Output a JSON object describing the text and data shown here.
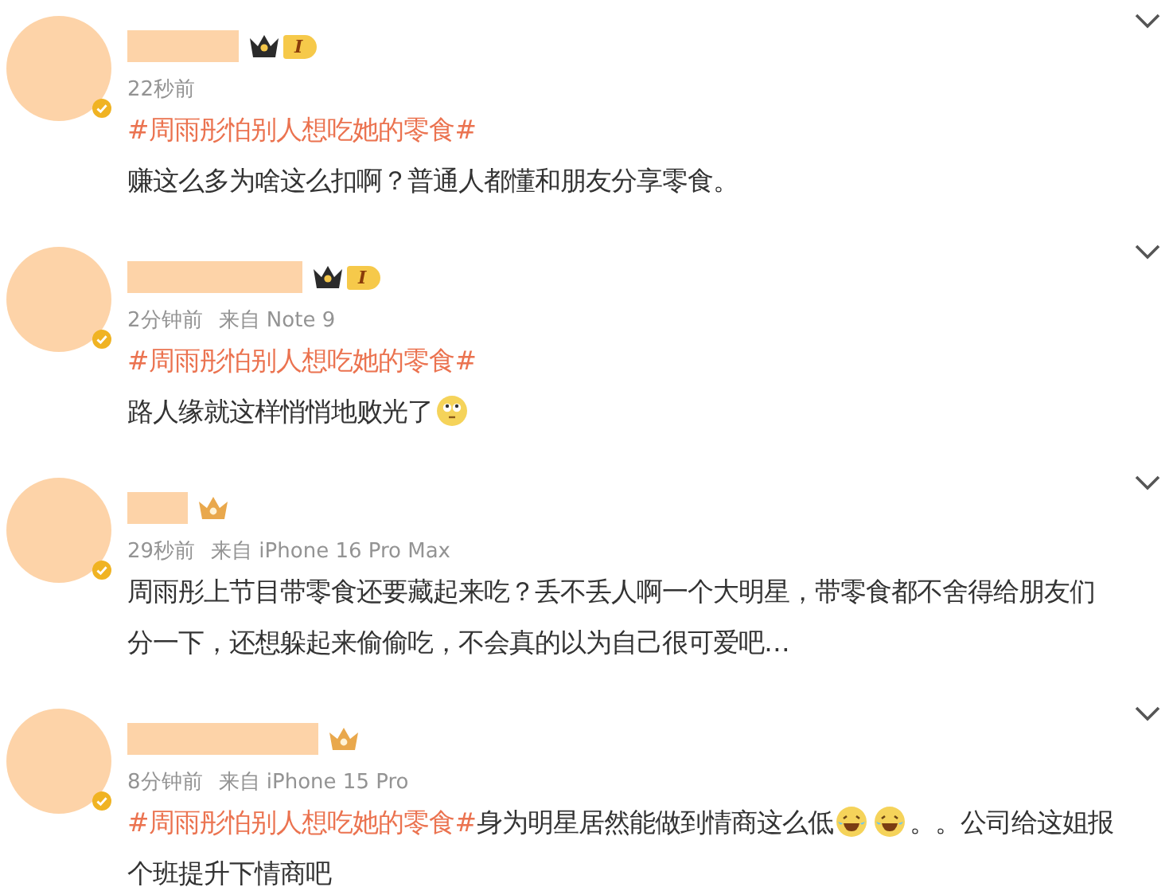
{
  "comments": [
    {
      "badge": {
        "kind": "level",
        "text": "I"
      },
      "time": "22秒前",
      "paragraphs": [
        [
          {
            "kind": "topic",
            "text": "#周雨彤怕别人想吃她的零食#"
          }
        ],
        [
          {
            "kind": "text",
            "text": "赚这么多为啥这么扣啊？普通人都懂和朋友分享零食。"
          }
        ]
      ]
    },
    {
      "badge": {
        "kind": "level",
        "text": "I"
      },
      "time": "2分钟前",
      "source": "来自 Note 9",
      "paragraphs": [
        [
          {
            "kind": "topic",
            "text": "#周雨彤怕别人想吃她的零食#"
          }
        ],
        [
          {
            "kind": "text",
            "text": "路人缘就这样悄悄地败光了"
          },
          {
            "kind": "emoji-eyes"
          }
        ]
      ]
    },
    {
      "badge": {
        "kind": "crown"
      },
      "time": "29秒前",
      "source": "来自 iPhone 16 Pro Max",
      "paragraphs": [
        [
          {
            "kind": "text",
            "text": "周雨彤上节目带零食还要藏起来吃？丢不丢人啊一个大明星，带零食都不舍得给朋友们"
          }
        ],
        [
          {
            "kind": "text",
            "text": "分一下，还想躲起来偷偷吃，不会真的以为自己很可爱吧…"
          }
        ]
      ]
    },
    {
      "badge": {
        "kind": "crown"
      },
      "time": "8分钟前",
      "source": "来自 iPhone 15 Pro",
      "paragraphs": [
        [
          {
            "kind": "topic",
            "text": "#周雨彤怕别人想吃她的零食#"
          },
          {
            "kind": "text",
            "text": "身为明星居然能做到情商这么低"
          },
          {
            "kind": "emoji-laugh"
          },
          {
            "kind": "emoji-laugh"
          },
          {
            "kind": "text",
            "text": "。。公司给这姐报"
          }
        ],
        [
          {
            "kind": "text",
            "text": "个班提升下情商吧"
          }
        ]
      ]
    }
  ]
}
